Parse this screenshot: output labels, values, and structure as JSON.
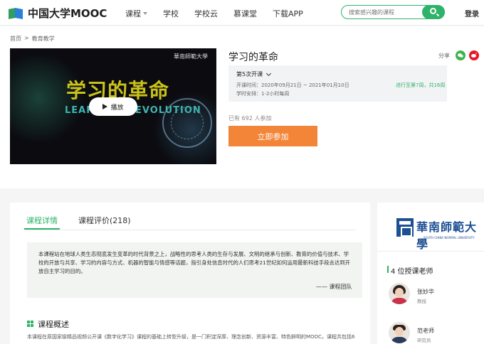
{
  "header": {
    "logo_text": "中国大学MOOC",
    "nav": [
      "课程",
      "学校",
      "学校云",
      "慕课堂",
      "下载APP"
    ],
    "search_placeholder": "搜索感兴趣的课程",
    "login": "登录",
    "colors": {
      "brand_green": "#2fb36a",
      "accent_orange": "#f28538"
    }
  },
  "breadcrumb": [
    "首页",
    ">",
    "教育教学"
  ],
  "cover": {
    "university_mark": "華南師範大學",
    "headline": "学习的革命",
    "english": "LEARNING REVOLUTION",
    "play_label": "播放"
  },
  "course": {
    "title": "学习的革命",
    "share_label": "分享",
    "term_label": "第5次开课",
    "open_time": "开课时间：2020年09月21日 ~ 2021年01月10日",
    "schedule": "学时安排：1-2小时每周",
    "progress": "进行至第7周，共16周",
    "enrolled": "已有 692 人参加",
    "join_label": "立即参加"
  },
  "tabs": {
    "details": "课程详情",
    "reviews": "课程评价(218)"
  },
  "intro": {
    "text": "本课程站在地球人类生态彻底发生变革的时代背景之上，战略性的思考人类的生存与发展、文明的继承与创新、教育的价值与技术、学校的开放与共享、学习的内容与方式、机器的智能与情感等话题，指引身处信息时代的人们思考21世纪如何运用最新科技手段去达到开放自主学习的目的。",
    "sign": "—— 课程团队"
  },
  "overview": {
    "title": "课程概述",
    "text": "本课程在原国家级精品视频公开课《数字化学习》课程的基础上转型升级，是一门积淀深厚、理念创新、资源丰富、特色鲜明的MOOC。课程共包括6"
  },
  "side": {
    "university_cn": "華南師範大學",
    "university_en": "SOUTH CHINA NORMAL UNIVERSITY",
    "teachers_heading": "4 位授课老师",
    "teachers": [
      {
        "name": "张妙华",
        "title": "教授"
      },
      {
        "name": "范老师",
        "title": "研究员"
      }
    ]
  }
}
